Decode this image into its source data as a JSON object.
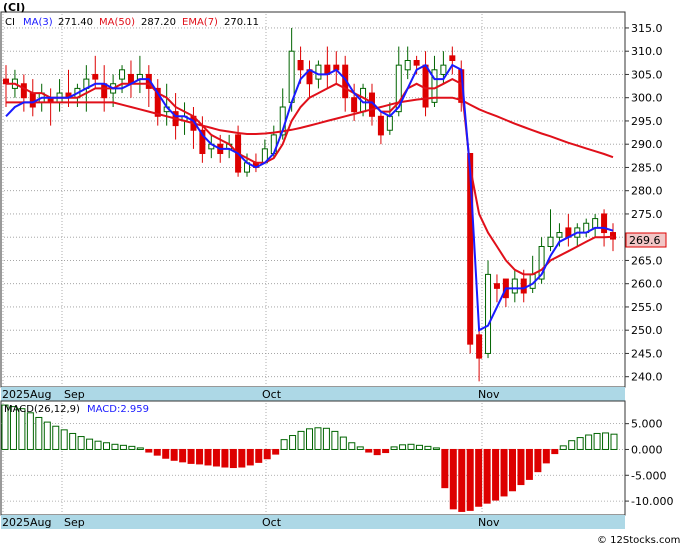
{
  "ticker": "(CI)",
  "price_legend": {
    "ma3_label": "MA(3)",
    "ma3_value": "271.40",
    "ma50_label": "MA(50)",
    "ma50_value": "287.20",
    "ema7_label": "EMA(7)",
    "ema7_value": "270.11"
  },
  "last_price_label": "269.6",
  "macd_legend": {
    "params": "MACD(26,12,9)",
    "label": "MACD:2.959"
  },
  "x_labels": {
    "year_month": "2025Aug",
    "sep": "Sep",
    "oct": "Oct",
    "nov": "Nov"
  },
  "watermark": "© 12Stocks.com",
  "colors": {
    "up": "#006400",
    "down": "#dd0000",
    "ma_fast": "#1a1aff",
    "ma_slow": "#e0101a",
    "axis_band": "#add8e6"
  },
  "chart_data": [
    {
      "type": "candlestick",
      "ylim": [
        238,
        318
      ],
      "yticks": [
        "240.0",
        "245.0",
        "250.0",
        "255.0",
        "260.0",
        "265.0",
        "270.0",
        "275.0",
        "280.0",
        "285.0",
        "290.0",
        "295.0",
        "300.0",
        "305.0",
        "310.0",
        "315.0"
      ],
      "ytick_values": [
        240,
        245,
        250,
        255,
        260,
        265,
        270,
        275,
        280,
        285,
        290,
        295,
        300,
        305,
        310,
        315
      ],
      "grid": true,
      "candles": [
        [
          304,
          303,
          298,
          307
        ],
        [
          302,
          304,
          300,
          306
        ],
        [
          303,
          300,
          297,
          305
        ],
        [
          301,
          298,
          296,
          304
        ],
        [
          299,
          301,
          297,
          303
        ],
        [
          300,
          299,
          294,
          302
        ],
        [
          299,
          301,
          297,
          304
        ],
        [
          301,
          300,
          298,
          306
        ],
        [
          300,
          302,
          298,
          303
        ],
        [
          302,
          304,
          297,
          307
        ],
        [
          305,
          304,
          302,
          309
        ],
        [
          303,
          300,
          297,
          307
        ],
        [
          301,
          303,
          298,
          305
        ],
        [
          304,
          306,
          301,
          307
        ],
        [
          305,
          303,
          300,
          308
        ],
        [
          304,
          305,
          301,
          309
        ],
        [
          305,
          302,
          298,
          307
        ],
        [
          302,
          296,
          294,
          304
        ],
        [
          297,
          298,
          294,
          303
        ],
        [
          297,
          294,
          291,
          301
        ],
        [
          295,
          296,
          292,
          299
        ],
        [
          296,
          293,
          289,
          298
        ],
        [
          293,
          288,
          286,
          296
        ],
        [
          289,
          290,
          287,
          292
        ],
        [
          290,
          288,
          286,
          292
        ],
        [
          289,
          290,
          287,
          292
        ],
        [
          292,
          284,
          283,
          294
        ],
        [
          284,
          286,
          283,
          288
        ],
        [
          286,
          285,
          284,
          288
        ],
        [
          286,
          289,
          286,
          291
        ],
        [
          288,
          292,
          287,
          294
        ],
        [
          292,
          298,
          291,
          302
        ],
        [
          299,
          310,
          297,
          315
        ],
        [
          308,
          306,
          303,
          311
        ],
        [
          306,
          303,
          300,
          308
        ],
        [
          304,
          307,
          302,
          308
        ],
        [
          307,
          305,
          302,
          311
        ],
        [
          307,
          306,
          303,
          310
        ],
        [
          307,
          300,
          297,
          309
        ],
        [
          300,
          297,
          295,
          303
        ],
        [
          297,
          302,
          296,
          303
        ],
        [
          301,
          296,
          294,
          303
        ],
        [
          296,
          292,
          290,
          297
        ],
        [
          293,
          296,
          292,
          299
        ],
        [
          297,
          307,
          296,
          311
        ],
        [
          306,
          308,
          304,
          311
        ],
        [
          308,
          307,
          305,
          309
        ],
        [
          307,
          298,
          296,
          310
        ],
        [
          299,
          306,
          298,
          309
        ],
        [
          305,
          307,
          303,
          310
        ],
        [
          309,
          308,
          305,
          311
        ],
        [
          306,
          299,
          297,
          308
        ],
        [
          288,
          247,
          245,
          273
        ],
        [
          249,
          244,
          239,
          250
        ],
        [
          245,
          262,
          244,
          265
        ],
        [
          260,
          259,
          256,
          262
        ],
        [
          261,
          257,
          255,
          260
        ],
        [
          258,
          261,
          256,
          263
        ],
        [
          261,
          258,
          256,
          263
        ],
        [
          259,
          262,
          258,
          266
        ],
        [
          261,
          268,
          260,
          270
        ],
        [
          268,
          270,
          267,
          276
        ],
        [
          270,
          271,
          268,
          273
        ],
        [
          272,
          270,
          268,
          275
        ],
        [
          270,
          272,
          268,
          273
        ],
        [
          271,
          273,
          270,
          274
        ],
        [
          272,
          274,
          270,
          275
        ],
        [
          275,
          271,
          268,
          276
        ],
        [
          271,
          269.6,
          267,
          273
        ]
      ],
      "ma3": [
        296,
        298,
        299,
        299,
        300,
        300,
        300,
        300,
        301,
        302,
        303,
        303,
        302,
        302,
        303,
        304,
        304,
        301,
        298,
        296,
        296,
        295,
        292,
        290,
        289,
        289,
        288,
        286,
        285,
        286,
        288,
        293,
        299,
        304,
        306,
        305,
        305,
        306,
        304,
        301,
        299,
        299,
        297,
        296,
        298,
        302,
        306,
        307,
        304,
        304,
        307,
        306,
        284,
        250,
        251,
        255,
        259,
        259,
        259,
        260,
        262,
        266,
        269,
        270,
        271,
        271,
        272,
        272,
        271.4
      ],
      "ma50": [
        299,
        299,
        299,
        299,
        299,
        299,
        299,
        299,
        299,
        299,
        299,
        299,
        299,
        298.5,
        298,
        297.5,
        297,
        296.5,
        296,
        295.5,
        295,
        294.5,
        294,
        293.5,
        293,
        292.7,
        292.4,
        292.2,
        292.2,
        292.3,
        292.5,
        292.8,
        293.1,
        293.5,
        294,
        294.5,
        295,
        295.5,
        296,
        296.5,
        297,
        297.5,
        298,
        298.5,
        299,
        299.3,
        299.6,
        299.8,
        300,
        300,
        300,
        299.5,
        298.5,
        297.5,
        296.7,
        296,
        295.2,
        294.4,
        293.7,
        293,
        292.3,
        291.7,
        291,
        290.3,
        289.7,
        289.1,
        288.5,
        287.9,
        287.2
      ],
      "ema7": [
        303,
        303,
        302,
        301,
        301,
        300,
        300,
        300,
        300,
        301,
        302,
        302,
        302,
        303,
        303,
        303,
        303,
        301,
        300,
        298,
        297,
        296,
        294,
        292,
        291,
        290,
        288,
        287,
        286,
        286,
        287,
        290,
        295,
        298,
        300,
        301,
        302,
        303,
        302,
        301,
        300,
        299,
        297,
        297,
        299,
        302,
        303,
        302,
        302,
        303,
        304,
        303,
        285,
        275,
        271,
        268,
        265,
        263,
        262,
        262,
        263,
        265,
        266,
        267,
        268,
        269,
        270,
        270,
        270.11
      ]
    },
    {
      "type": "bar",
      "title": "MACD(26,12,9)",
      "ylim": [
        -12500,
        9000
      ],
      "yticks": [
        "5.000",
        "0.000",
        "-5.000",
        "-10.000"
      ],
      "ytick_values": [
        5000,
        0,
        -5000,
        -10000
      ],
      "values": [
        8600,
        8300,
        7900,
        7100,
        6200,
        5300,
        4500,
        3800,
        3100,
        2500,
        2000,
        1600,
        1300,
        1000,
        800,
        600,
        300,
        -500,
        -1100,
        -1700,
        -2100,
        -2400,
        -2700,
        -2800,
        -3000,
        -3200,
        -3400,
        -3500,
        -3400,
        -3000,
        -2500,
        -1800,
        -900,
        1900,
        2700,
        3500,
        4000,
        4200,
        4100,
        3500,
        2400,
        1300,
        500,
        -500,
        -1000,
        -600,
        500,
        900,
        1000,
        800,
        600,
        300,
        -7400,
        -11500,
        -12000,
        -11800,
        -11000,
        -10400,
        -9800,
        -9000,
        -8000,
        -6800,
        -5800,
        -4300,
        -2600,
        -800,
        700,
        1700,
        2300,
        2800,
        3100,
        3200,
        2959
      ]
    }
  ]
}
